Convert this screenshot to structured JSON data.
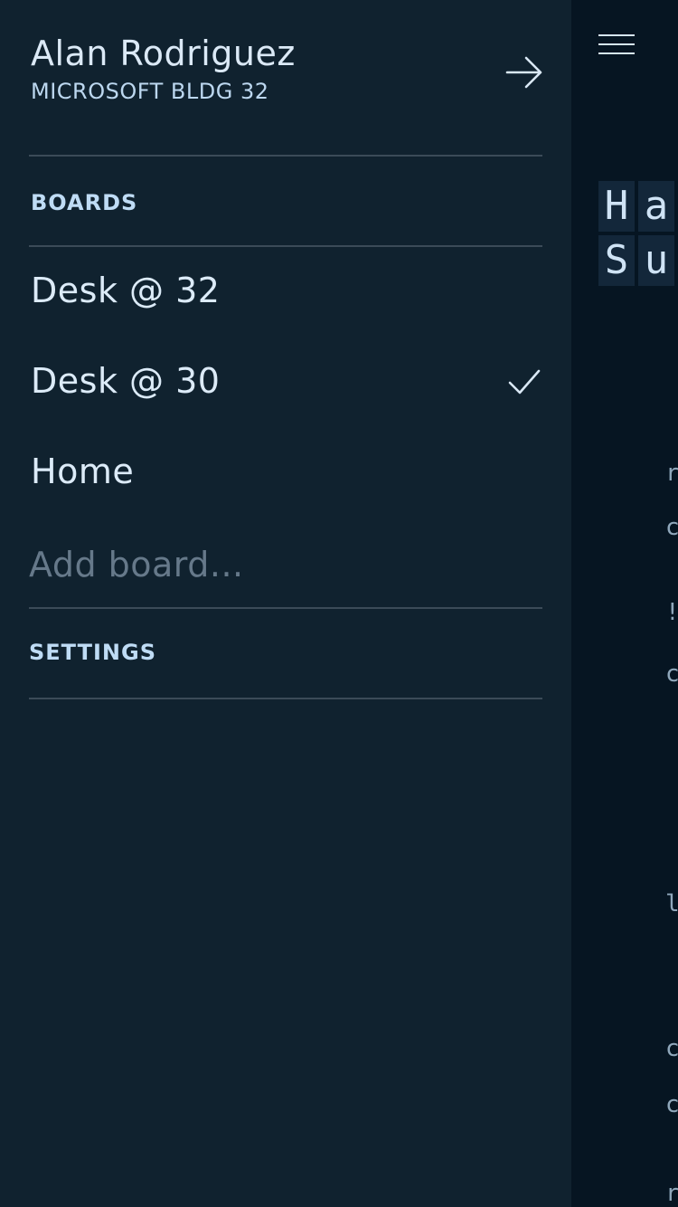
{
  "drawer": {
    "user": {
      "name": "Alan Rodriguez",
      "location": "MICROSOFT BLDG 32"
    },
    "boards_header": "BOARDS",
    "boards": [
      {
        "label": "Desk @ 32",
        "selected": false
      },
      {
        "label": "Desk @ 30",
        "selected": true
      },
      {
        "label": "Home",
        "selected": false
      }
    ],
    "add_board": {
      "placeholder": "Add board...",
      "value": ""
    },
    "settings_label": "SETTINGS"
  },
  "main": {
    "tiles_row1": [
      "H",
      "a"
    ],
    "tiles_row2": [
      "S",
      "u"
    ],
    "edge_glyphs": [
      "r",
      "c",
      "!",
      "c",
      "l",
      "c",
      "c",
      "r"
    ]
  },
  "icons": {
    "profile_arrow": "arrow-right-icon",
    "selected_check": "check-icon",
    "menu": "hamburger-menu-icon"
  },
  "colors": {
    "drawer_bg": "#10222f",
    "main_bg": "#061522",
    "accent_text": "#bfdcf5",
    "divider": "#3b4b58"
  }
}
